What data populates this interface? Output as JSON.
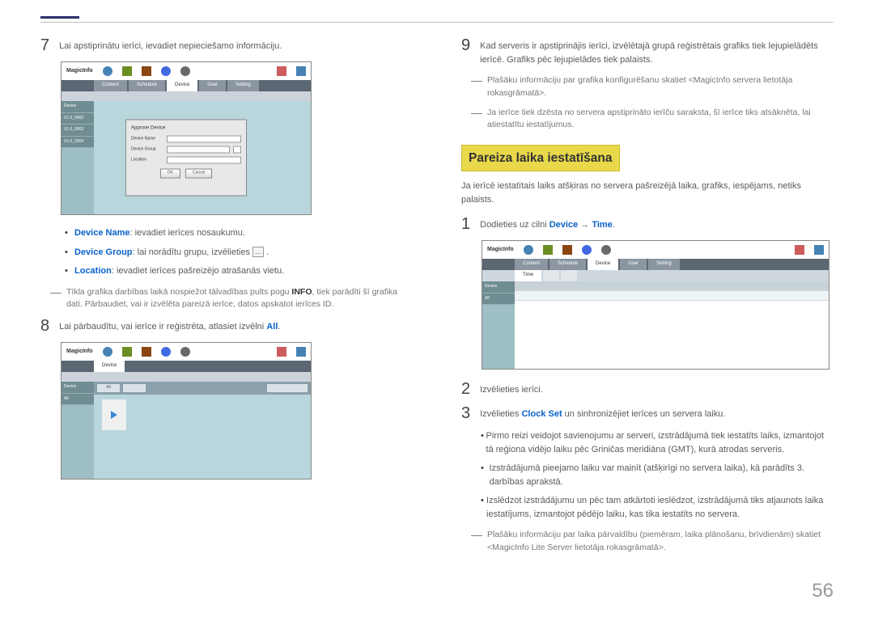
{
  "page_number": "56",
  "left": {
    "step7": {
      "num": "7",
      "text_before": "Lai apstiprinātu ierīci, ievadiet nepieciešamo informāciju.",
      "screenshot": {
        "logo": "MagicInfo",
        "tabs": [
          "Content",
          "Schedule",
          "Device",
          "User",
          "Setting"
        ],
        "sidebar": [
          "Device",
          "V1.0_0002",
          "V1.0_0003",
          "V1.0_0004"
        ],
        "dialog_title": "Approve Device",
        "fields": [
          {
            "label": "Device Name",
            "value": ""
          },
          {
            "label": "Device Group",
            "value": ""
          },
          {
            "label": "Location",
            "value": ""
          }
        ],
        "buttons": [
          "OK",
          "Cancel"
        ]
      },
      "bullets": [
        {
          "label": "Device Name",
          "rest": ": ievadiet ierīces nosaukumu."
        },
        {
          "label": "Device Group",
          "rest": ": lai norādītu grupu, izvēlieties "
        },
        {
          "label": "Location",
          "rest": ": ievadiet ierīces pašreizējo atrašanās vietu."
        }
      ],
      "icon_glyph": "…",
      "dash_text_pre": "Tīkla grafika darbības laikā nospiežot tālvadības pults pogu ",
      "dash_bold": "INFO",
      "dash_text_post": ", tiek parādīti šī grafika dati. Pārbaudiet, vai ir izvēlēta pareizā ierīce, datos apskatot ierīces ID."
    },
    "step8": {
      "num": "8",
      "text_before": "Lai pārbaudītu, vai ierīce ir reģistrēta, atlasiet izvēlni ",
      "blue": "All",
      "text_after": ".",
      "screenshot": {
        "chips": [
          "All",
          ""
        ],
        "sidebar": [
          "Device",
          "All"
        ]
      }
    }
  },
  "right": {
    "step9": {
      "num": "9",
      "text": "Kad serveris ir apstiprinājis ierīci, izvēlētajā grupā reģistrētais grafiks tiek lejupielādēts ierīcē. Grafiks pēc lejupielādes tiek palaists."
    },
    "dash1": "Plašāku informāciju par grafika konfigurēšanu skatiet <MagicInfo servera lietotāja rokasgrāmatā>.",
    "dash2": "Ja ierīce tiek dzēsta no servera apstiprināto ierīču saraksta, šī ierīce tiks atsāknēta, lai atiestatītu iestatījumus.",
    "heading": "Pareiza laika iestatīšana",
    "intro": "Ja ierīcē iestatītais laiks atšķiras no servera pašreizējā laika, grafiks, iespējams, netiks palaists.",
    "step1": {
      "num": "1",
      "text_before": "Dodieties uz cilni ",
      "blue1": "Device",
      "arrow": " → ",
      "blue2": "Time",
      "text_after": ".",
      "screenshot": {
        "logo": "MagicInfo",
        "tabs_row1": [
          "Content",
          "Schedule",
          "Device",
          "User",
          "Setting"
        ],
        "tabs_row2": [
          "Time",
          "",
          ""
        ],
        "sidebar": [
          "Device",
          "All"
        ]
      }
    },
    "step2": {
      "num": "2",
      "text": "Izvēlieties ierīci."
    },
    "step3": {
      "num": "3",
      "text_before": "Izvēlieties ",
      "blue": "Clock Set",
      "text_after": " un sinhronizējiet ierīces un servera laiku."
    },
    "bullets": [
      "Pirmo reizi veidojot savienojumu ar serveri, izstrādājumā tiek iestatīts laiks, izmantojot tā reģiona vidējo laiku pēc Griničas meridiāna (GMT), kurā atrodas serveris.",
      "Izstrādājumā pieejamo laiku var mainīt (atšķirīgi no servera laika), kā parādīts 3. darbības aprakstā.",
      "Izslēdzot izstrādājumu un pēc tam atkārtoti ieslēdzot, izstrādājumā tiks atjaunots laika iestatījums, izmantojot pēdējo laiku, kas tika iestatīts no servera."
    ],
    "dash3": "Plašāku informāciju par laika pārvaldību (piemēram, laika plānošanu, brīvdienām) skatiet <MagicInfo Lite Server lietotāja rokasgrāmatā>.",
    "icon_colors": {
      "globe": "#4682b4",
      "test": "#6b8e23",
      "monitor": "#8b4513",
      "user": "#4169e1",
      "gear": "#696969",
      "cal1": "#cd5c5c",
      "cal2": "#4682b4"
    }
  }
}
